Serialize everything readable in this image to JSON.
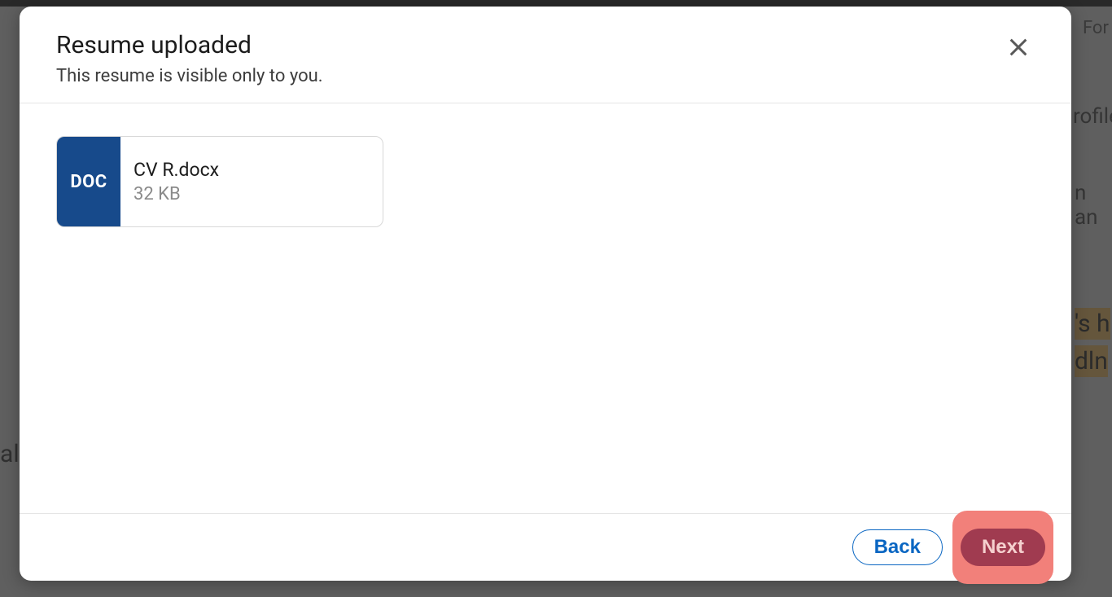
{
  "modal": {
    "title": "Resume uploaded",
    "subtitle": "This resume is visible only to you."
  },
  "file": {
    "badge": "DOC",
    "name": "CV R.docx",
    "size": "32 KB"
  },
  "footer": {
    "back_label": "Back",
    "next_label": "Next"
  },
  "background": {
    "frag1": "For",
    "frag2": "rofile",
    "frag3": "n an",
    "frag4": "'s h",
    "frag5": "dln",
    "frag6": "al"
  }
}
